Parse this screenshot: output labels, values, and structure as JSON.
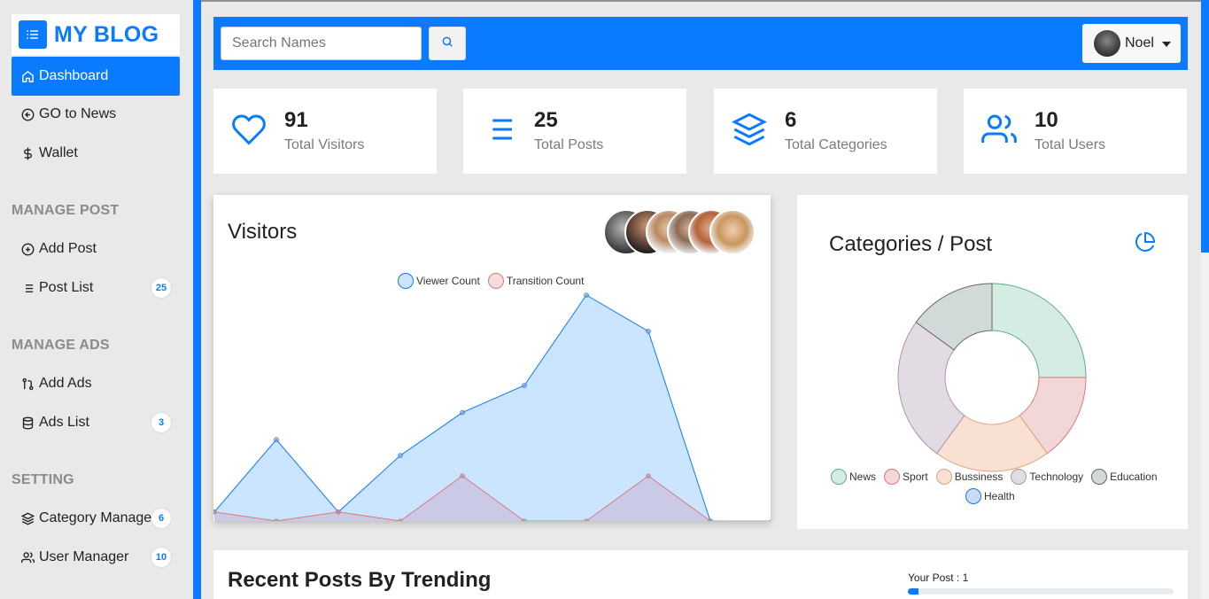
{
  "brand": {
    "title": "MY BLOG"
  },
  "sidebar": {
    "items": [
      {
        "label": "Dashboard",
        "icon": "home-icon",
        "active": true
      },
      {
        "label": "GO to News",
        "icon": "arrow-left-circle-icon"
      },
      {
        "label": "Wallet",
        "icon": "dollar-icon"
      }
    ],
    "sections": [
      {
        "title": "MANAGE POST",
        "items": [
          {
            "label": "Add Post",
            "icon": "plus-circle-icon"
          },
          {
            "label": "Post List",
            "icon": "list-icon",
            "badge": "25"
          }
        ]
      },
      {
        "title": "MANAGE ADS",
        "items": [
          {
            "label": "Add Ads",
            "icon": "git-pull-icon"
          },
          {
            "label": "Ads List",
            "icon": "database-icon",
            "badge": "3"
          }
        ]
      },
      {
        "title": "SETTING",
        "items": [
          {
            "label": "Category Manager",
            "icon": "layers-icon",
            "badge": "6"
          },
          {
            "label": "User Manager",
            "icon": "users-icon",
            "badge": "10"
          }
        ]
      }
    ]
  },
  "search": {
    "placeholder": "Search Names"
  },
  "user": {
    "name": "Noel"
  },
  "stats": [
    {
      "value": "91",
      "label": "Total Visitors",
      "icon": "heart-icon"
    },
    {
      "value": "25",
      "label": "Total Posts",
      "icon": "list-icon"
    },
    {
      "value": "6",
      "label": "Total Categories",
      "icon": "layers-icon"
    },
    {
      "value": "10",
      "label": "Total Users",
      "icon": "users-icon"
    }
  ],
  "visitors": {
    "title": "Visitors"
  },
  "categories": {
    "title": "Categories / Post"
  },
  "recent": {
    "title": "Recent Posts By Trending",
    "your_post": "Your Post : 1",
    "progress": 0.04
  },
  "colors": {
    "accent": "#0a7bff",
    "sidebar_bg": "#e9e9e9"
  },
  "chart_data": [
    {
      "type": "area",
      "title": "",
      "x": [
        0,
        1,
        2,
        3,
        4,
        5,
        6,
        7,
        8,
        9
      ],
      "ylim": [
        0,
        10
      ],
      "series": [
        {
          "name": "Viewer Count",
          "values": [
            0.4,
            3.6,
            0.4,
            2.9,
            4.8,
            6.0,
            10.0,
            8.4,
            0,
            0
          ],
          "color": "#0a7bff",
          "fill": "rgba(160,205,255,0.55)"
        },
        {
          "name": "Transition Count",
          "values": [
            0.4,
            0,
            0.4,
            0,
            2.0,
            0,
            0,
            2.0,
            0,
            0
          ],
          "color": "#d77a7a",
          "fill": "rgba(205,170,200,0.45)"
        }
      ],
      "legend": "top-center"
    },
    {
      "type": "pie",
      "title": "",
      "donut": true,
      "labels": [
        "News",
        "Sport",
        "Bussiness",
        "Technology",
        "Education",
        "Health"
      ],
      "values": [
        5,
        3,
        4,
        5,
        3,
        0
      ],
      "colors": [
        "#d4ece1",
        "#f1d7d8",
        "#f8e0d2",
        "#e2dbe3",
        "#d1dad9",
        "#c9dcf3"
      ],
      "strokes": [
        "#5fae85",
        "#d77a7a",
        "#e5a276",
        "#a896a8",
        "#666",
        "#0a7bff"
      ],
      "legend": "bottom"
    }
  ]
}
